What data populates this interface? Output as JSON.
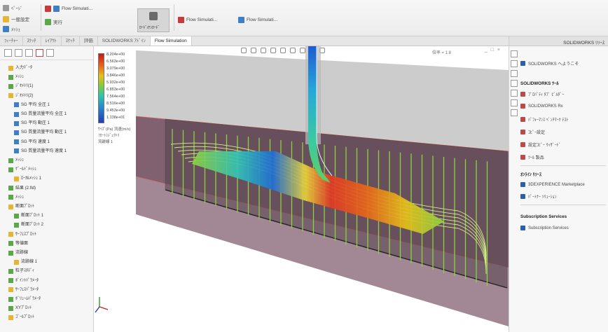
{
  "ribbon": {
    "items": [
      "ﾍﾟｰｼﾞ",
      "一般設定",
      "ﾒｯｼｭ",
      "Flow Simulati...",
      "実行",
      "ﾛｰﾄﾞ/ｱﾝﾛｰﾄﾞ",
      "Flow Simulati...",
      "Flow Simulati..."
    ]
  },
  "tabs": [
    "ﾌｨｰﾁｬｰ",
    "ｽｹｯﾁ",
    "ﾚｲｱｳﾄ",
    "ｽｹｯﾁ",
    "評価",
    "SOLIDWORKS ｱﾄﾞｲﾝ",
    "Flow Simulation"
  ],
  "tabs_active": "Flow Simulation",
  "left_tree": [
    "入力ﾃﾞｰﾀ",
    "ﾒｯｼｭ",
    "ｼﾞｵﾒﾄﾘ(1)",
    "ｼﾞｵﾒﾄﾘ(2)",
    "SG 平均 全圧 1",
    "SG 質量流量平均 全圧 1",
    "SG 平均 動圧 1",
    "SG 質量流量平均 動圧 1",
    "SG 平均 速度 1",
    "SG 質量流量平均 速度 1",
    "ﾒｯｼｭ",
    "ｹﾞｰﾙﾄﾞﾒｯｼｭ",
    "ﾛｰｶﾙﾒｯｼｭ 1",
    "結果 (2.fld)",
    "ﾒｯｼｭ",
    "断面ﾌﾟﾛｯﾄ",
    "断面ﾌﾟﾛｯﾄ 1",
    "断面ﾌﾟﾛｯﾄ 2",
    "ｻｰﾌｪｽﾌﾟﾛｯﾄ",
    "等値面",
    "流跡線",
    "流跡線 1",
    "粒子ｽﾀﾃﾞｨ",
    "ﾎﾟｲﾝﾄﾊﾟﾗﾒｰﾀ",
    "ｻｰﾌｪｽﾊﾟﾗﾒｰﾀ",
    "ﾎﾞﾘｭｰﾑﾊﾟﾗﾒｰﾀ",
    "XYﾌﾟﾛｯﾄ",
    "ｺﾞｰﾙﾌﾟﾛｯﾄ"
  ],
  "viewport": {
    "zoom_readout": "倍率 = 1:8"
  },
  "legend": {
    "values": [
      "8.204e+00",
      "6.563e+00",
      "3.079e+00",
      "3.846e+00",
      "5.932e+00",
      "6.853e+00",
      "7.564e+00",
      "8.516e+00",
      "9.453e+00",
      "1.138e+01"
    ],
    "caption_1": "ｻｲｽﾞ(Pa) 流速(m/s)",
    "caption_2": "ﾌﾛｰﾄﾗｼﾞｪｸﾄﾘ",
    "caption_3": "流跡線 1"
  },
  "taskpane": {
    "title": "SOLIDWORKS ﾘｿｰｽ",
    "welcome": "SOLIDWORKS へようこそ",
    "tools_heading": "SOLIDWORKS ﾂｰﾙ",
    "tools": [
      "ﾌﾟﾛﾊﾟﾃｨ ﾀﾌﾞ ﾋﾞﾙﾀﾞｰ",
      "SOLIDWORKS Rx",
      "ﾊﾟﾌｫｰﾏﾝｽ ﾍﾞﾝﾁﾏｰｸ ﾃｽﾄ",
      "ｺﾋﾟｰ設定",
      "設定ｺﾋﾟｰ ｳｨｻﾞｰﾄﾞ",
      "ﾂｰﾙ 製品"
    ],
    "online_heading": "ｵﾝﾗｲﾝ ﾘｿｰｽ",
    "online": [
      "3DEXPERIENCE Marketplace",
      "ﾊﾟｰﾄﾅｰ ｿﾘｭｰｼｮﾝ"
    ],
    "subscription_heading": "Subscription Services",
    "subscription": [
      "Subscription Services"
    ]
  },
  "colors": {
    "enclosure": "#6f4a5c",
    "streamline_green": "#8ed23f",
    "accent_red": "#d93a2b",
    "accent_blue": "#1d76d2"
  }
}
